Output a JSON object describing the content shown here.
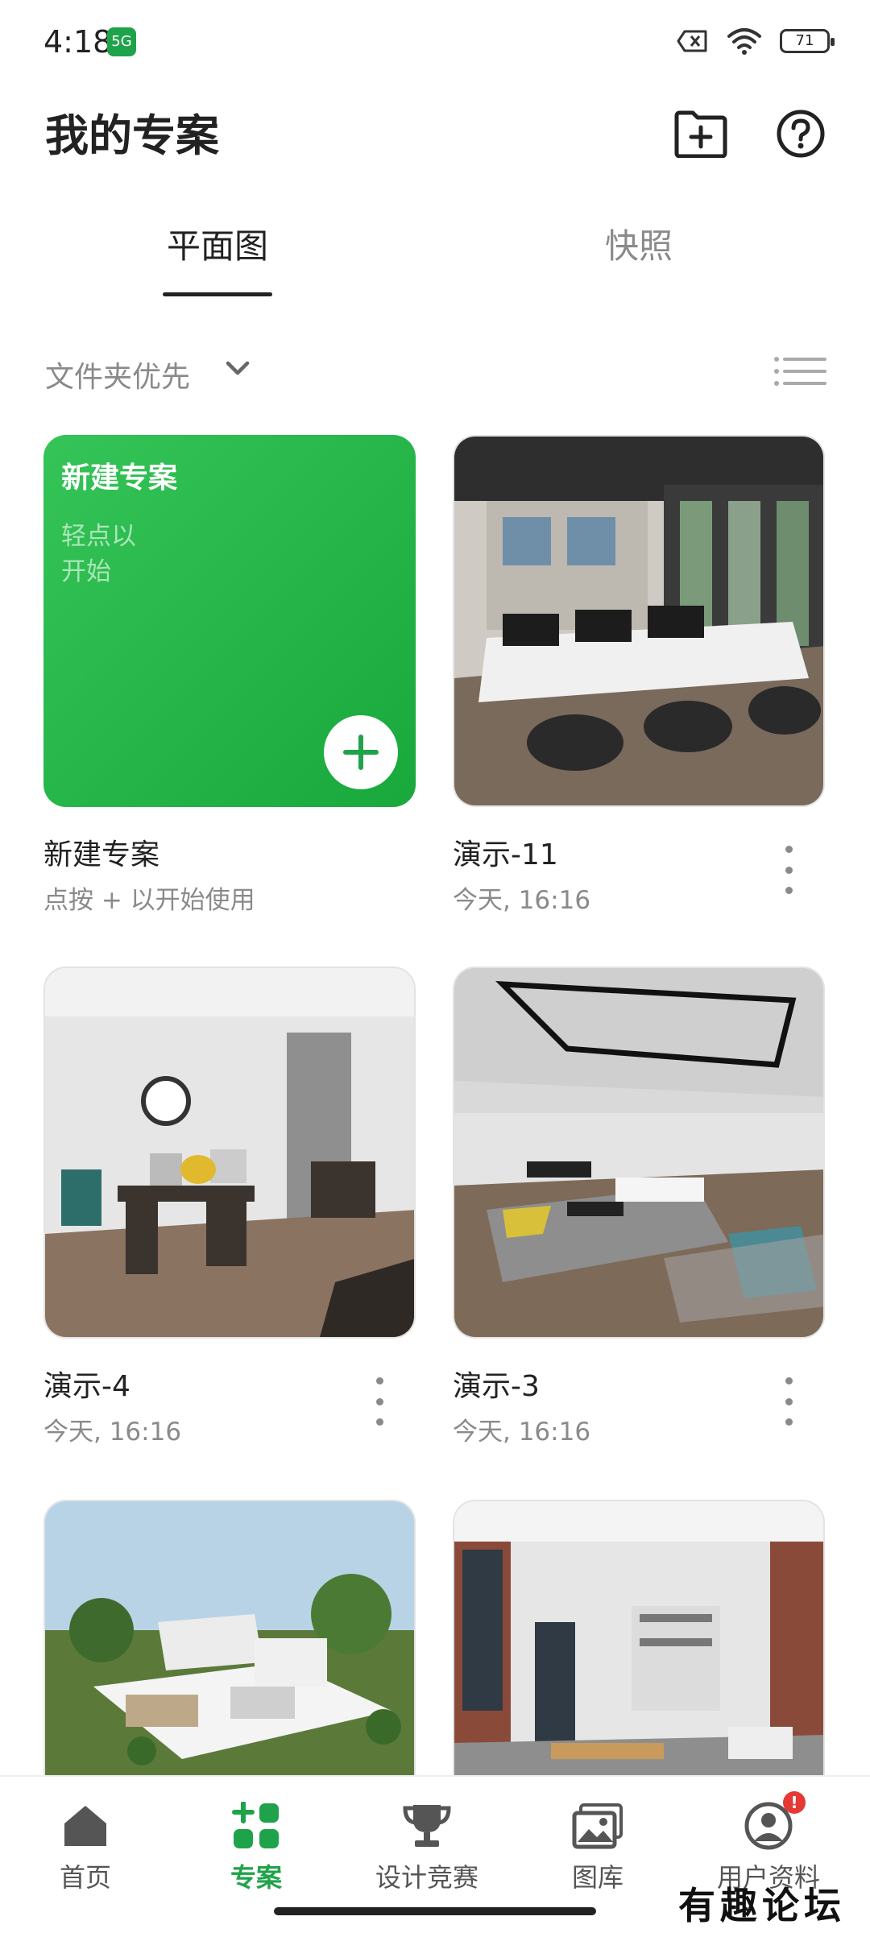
{
  "status_bar": {
    "time": "4:18",
    "network_badge": "5G",
    "battery": "71"
  },
  "header": {
    "title": "我的专案",
    "new_folder_icon": "folder-plus-icon",
    "help_icon": "help-circle-icon"
  },
  "tabs": [
    {
      "label": "平面图",
      "active": true
    },
    {
      "label": "快照",
      "active": false
    }
  ],
  "sort": {
    "label": "文件夹优先",
    "list_view_icon": "list-view-icon"
  },
  "new_project": {
    "card_title": "新建专案",
    "card_hint": "轻点以开始",
    "title": "新建专案",
    "subtitle": "点按 + 以开始使用"
  },
  "projects": [
    {
      "name": "演示-11",
      "date": "今天, 16:16",
      "scene": "office-open"
    },
    {
      "name": "演示-4",
      "date": "今天, 16:16",
      "scene": "office-small"
    },
    {
      "name": "演示-3",
      "date": "今天, 16:16",
      "scene": "living-room"
    },
    {
      "name": "",
      "date": "",
      "scene": "house-3d"
    },
    {
      "name": "",
      "date": "",
      "scene": "loft"
    }
  ],
  "bottom_nav": [
    {
      "label": "首页",
      "icon": "home-icon",
      "active": false
    },
    {
      "label": "专案",
      "icon": "projects-grid-icon",
      "active": true
    },
    {
      "label": "设计竞赛",
      "icon": "trophy-icon",
      "active": false
    },
    {
      "label": "图库",
      "icon": "gallery-icon",
      "active": false
    },
    {
      "label": "用户资料",
      "icon": "user-profile-icon",
      "active": false,
      "badge": "!"
    }
  ],
  "watermark": "有趣论坛",
  "colors": {
    "accent": "#1fa34a",
    "new_card_gradient_start": "#35c457",
    "new_card_gradient_end": "#18a83c",
    "text_primary": "#222222",
    "text_secondary": "#8a8a8a",
    "notification": "#e53935"
  }
}
